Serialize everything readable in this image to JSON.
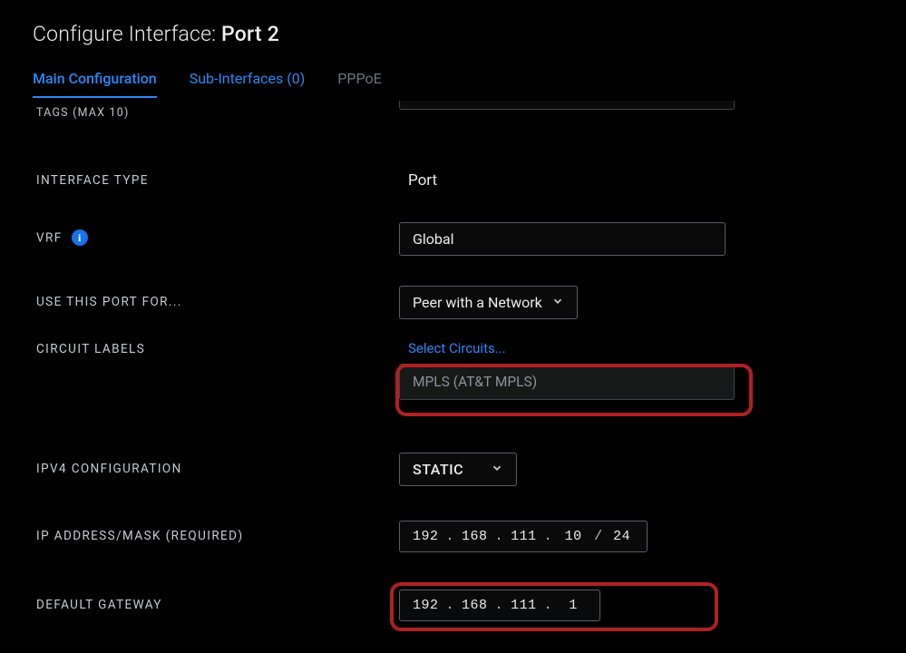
{
  "title": {
    "prefix": "Configure Interface: ",
    "port": "Port 2"
  },
  "tabs": {
    "main": "Main Configuration",
    "sub": "Sub-Interfaces (0)",
    "pppoe": "PPPoE"
  },
  "cutoff_label": "TAGS (MAX 10)",
  "fields": {
    "interface_type": {
      "label": "INTERFACE TYPE",
      "value": "Port"
    },
    "vrf": {
      "label": "VRF",
      "info_icon": "i",
      "value": "Global"
    },
    "use_for": {
      "label": "USE THIS PORT FOR...",
      "value": "Peer with a Network"
    },
    "circuit": {
      "label": "CIRCUIT LABELS",
      "link": "Select Circuits...",
      "value": "MPLS (AT&T MPLS)"
    },
    "ipv4": {
      "label": "IPV4 CONFIGURATION",
      "value": "STATIC"
    },
    "ip": {
      "label": "IP ADDRESS/MASK (REQUIRED)",
      "o1": "192",
      "o2": "168",
      "o3": "111",
      "o4": "10",
      "mask": "24"
    },
    "gw": {
      "label": "DEFAULT GATEWAY",
      "o1": "192",
      "o2": "168",
      "o3": "111",
      "o4": "1"
    }
  },
  "glyph": {
    "dot": ".",
    "slash": "/"
  }
}
